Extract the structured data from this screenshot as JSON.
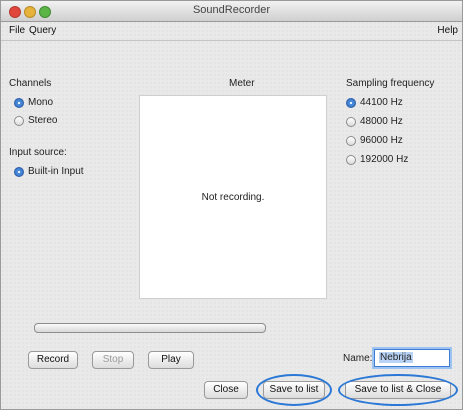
{
  "window": {
    "title": "SoundRecorder"
  },
  "menu": {
    "file": "File",
    "query": "Query",
    "help": "Help"
  },
  "channels": {
    "label": "Channels",
    "options": [
      "Mono",
      "Stereo"
    ],
    "selected": "Mono"
  },
  "input_source": {
    "label": "Input source:",
    "options": [
      "Built-in Input"
    ],
    "selected": "Built-in Input"
  },
  "meter": {
    "label": "Meter",
    "status": "Not recording."
  },
  "sampling": {
    "label": "Sampling frequency",
    "options": [
      "44100 Hz",
      "48000 Hz",
      "96000 Hz",
      "192000 Hz"
    ],
    "selected": "44100 Hz"
  },
  "progress": {
    "value": 0
  },
  "buttons": {
    "record": "Record",
    "stop": "Stop",
    "play": "Play",
    "close": "Close",
    "save_to_list": "Save to list",
    "save_to_list_close": "Save to list & Close"
  },
  "name": {
    "label": "Name:",
    "value": "Nebrija"
  },
  "colors": {
    "accent": "#2b78d6",
    "selection": "#b8d3f5"
  }
}
